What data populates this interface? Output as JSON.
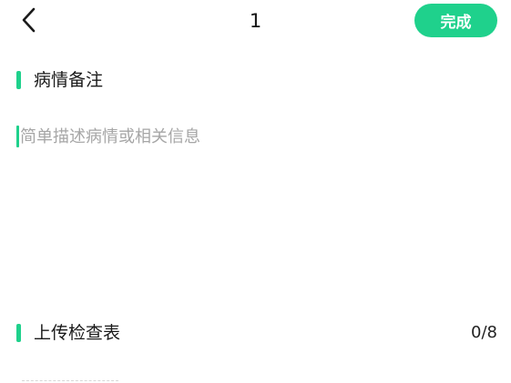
{
  "header": {
    "back_icon": "chevron-left-icon",
    "title": "1",
    "done_label": "完成"
  },
  "notes_section": {
    "label": "病情备注",
    "input_value": "",
    "placeholder": "简单描述病情或相关信息"
  },
  "upload_section": {
    "label": "上传检查表",
    "count": "0/8"
  },
  "colors": {
    "accent": "#1fd18c",
    "placeholder": "#a6a6a6",
    "text": "#1a1a1a",
    "background": "#ffffff"
  }
}
